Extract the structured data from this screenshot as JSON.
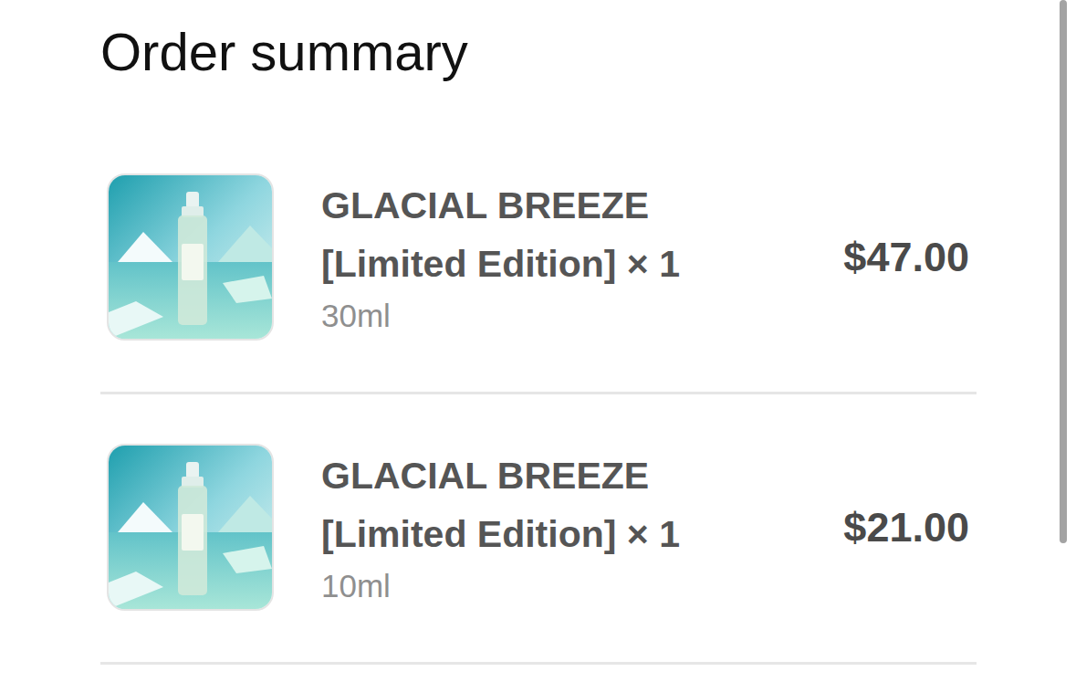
{
  "title": "Order summary",
  "items": [
    {
      "name": "GLACIAL BREEZE [Limited Edition]",
      "quantity": "× 1",
      "variant": "30ml",
      "price": "$47.00"
    },
    {
      "name": "GLACIAL BREEZE [Limited Edition]",
      "quantity": "× 1",
      "variant": "10ml",
      "price": "$21.00"
    }
  ]
}
